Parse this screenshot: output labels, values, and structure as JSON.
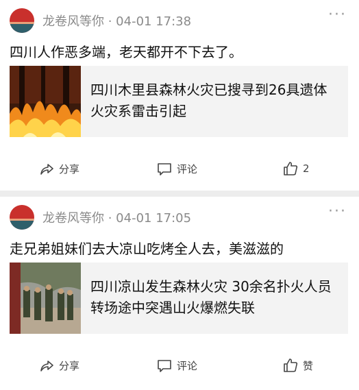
{
  "posts": [
    {
      "author": "龙卷风等你",
      "time": "04-01 17:38",
      "text": "四川人作恶多端，老天都开不下去了。",
      "card": {
        "title": "四川木里县森林火灾已搜寻到26具遗体 火灾系雷击引起"
      },
      "share_label": "分享",
      "comment_label": "评论",
      "like_label": "2"
    },
    {
      "author": "龙卷风等你",
      "time": "04-01 17:05",
      "text": "走兄弟姐妹们去大凉山吃烤全人去，美滋滋的",
      "card": {
        "title": "四川凉山发生森林火灾 30余名扑火人员转场途中突遇山火爆燃失联"
      },
      "share_label": "分享",
      "comment_label": "评论",
      "like_label": "赞"
    }
  ],
  "separator": " · ",
  "more_glyph": "···",
  "colors": {
    "background": "#ededed",
    "card": "#f3f3f3",
    "meta": "#8a8a8a"
  }
}
